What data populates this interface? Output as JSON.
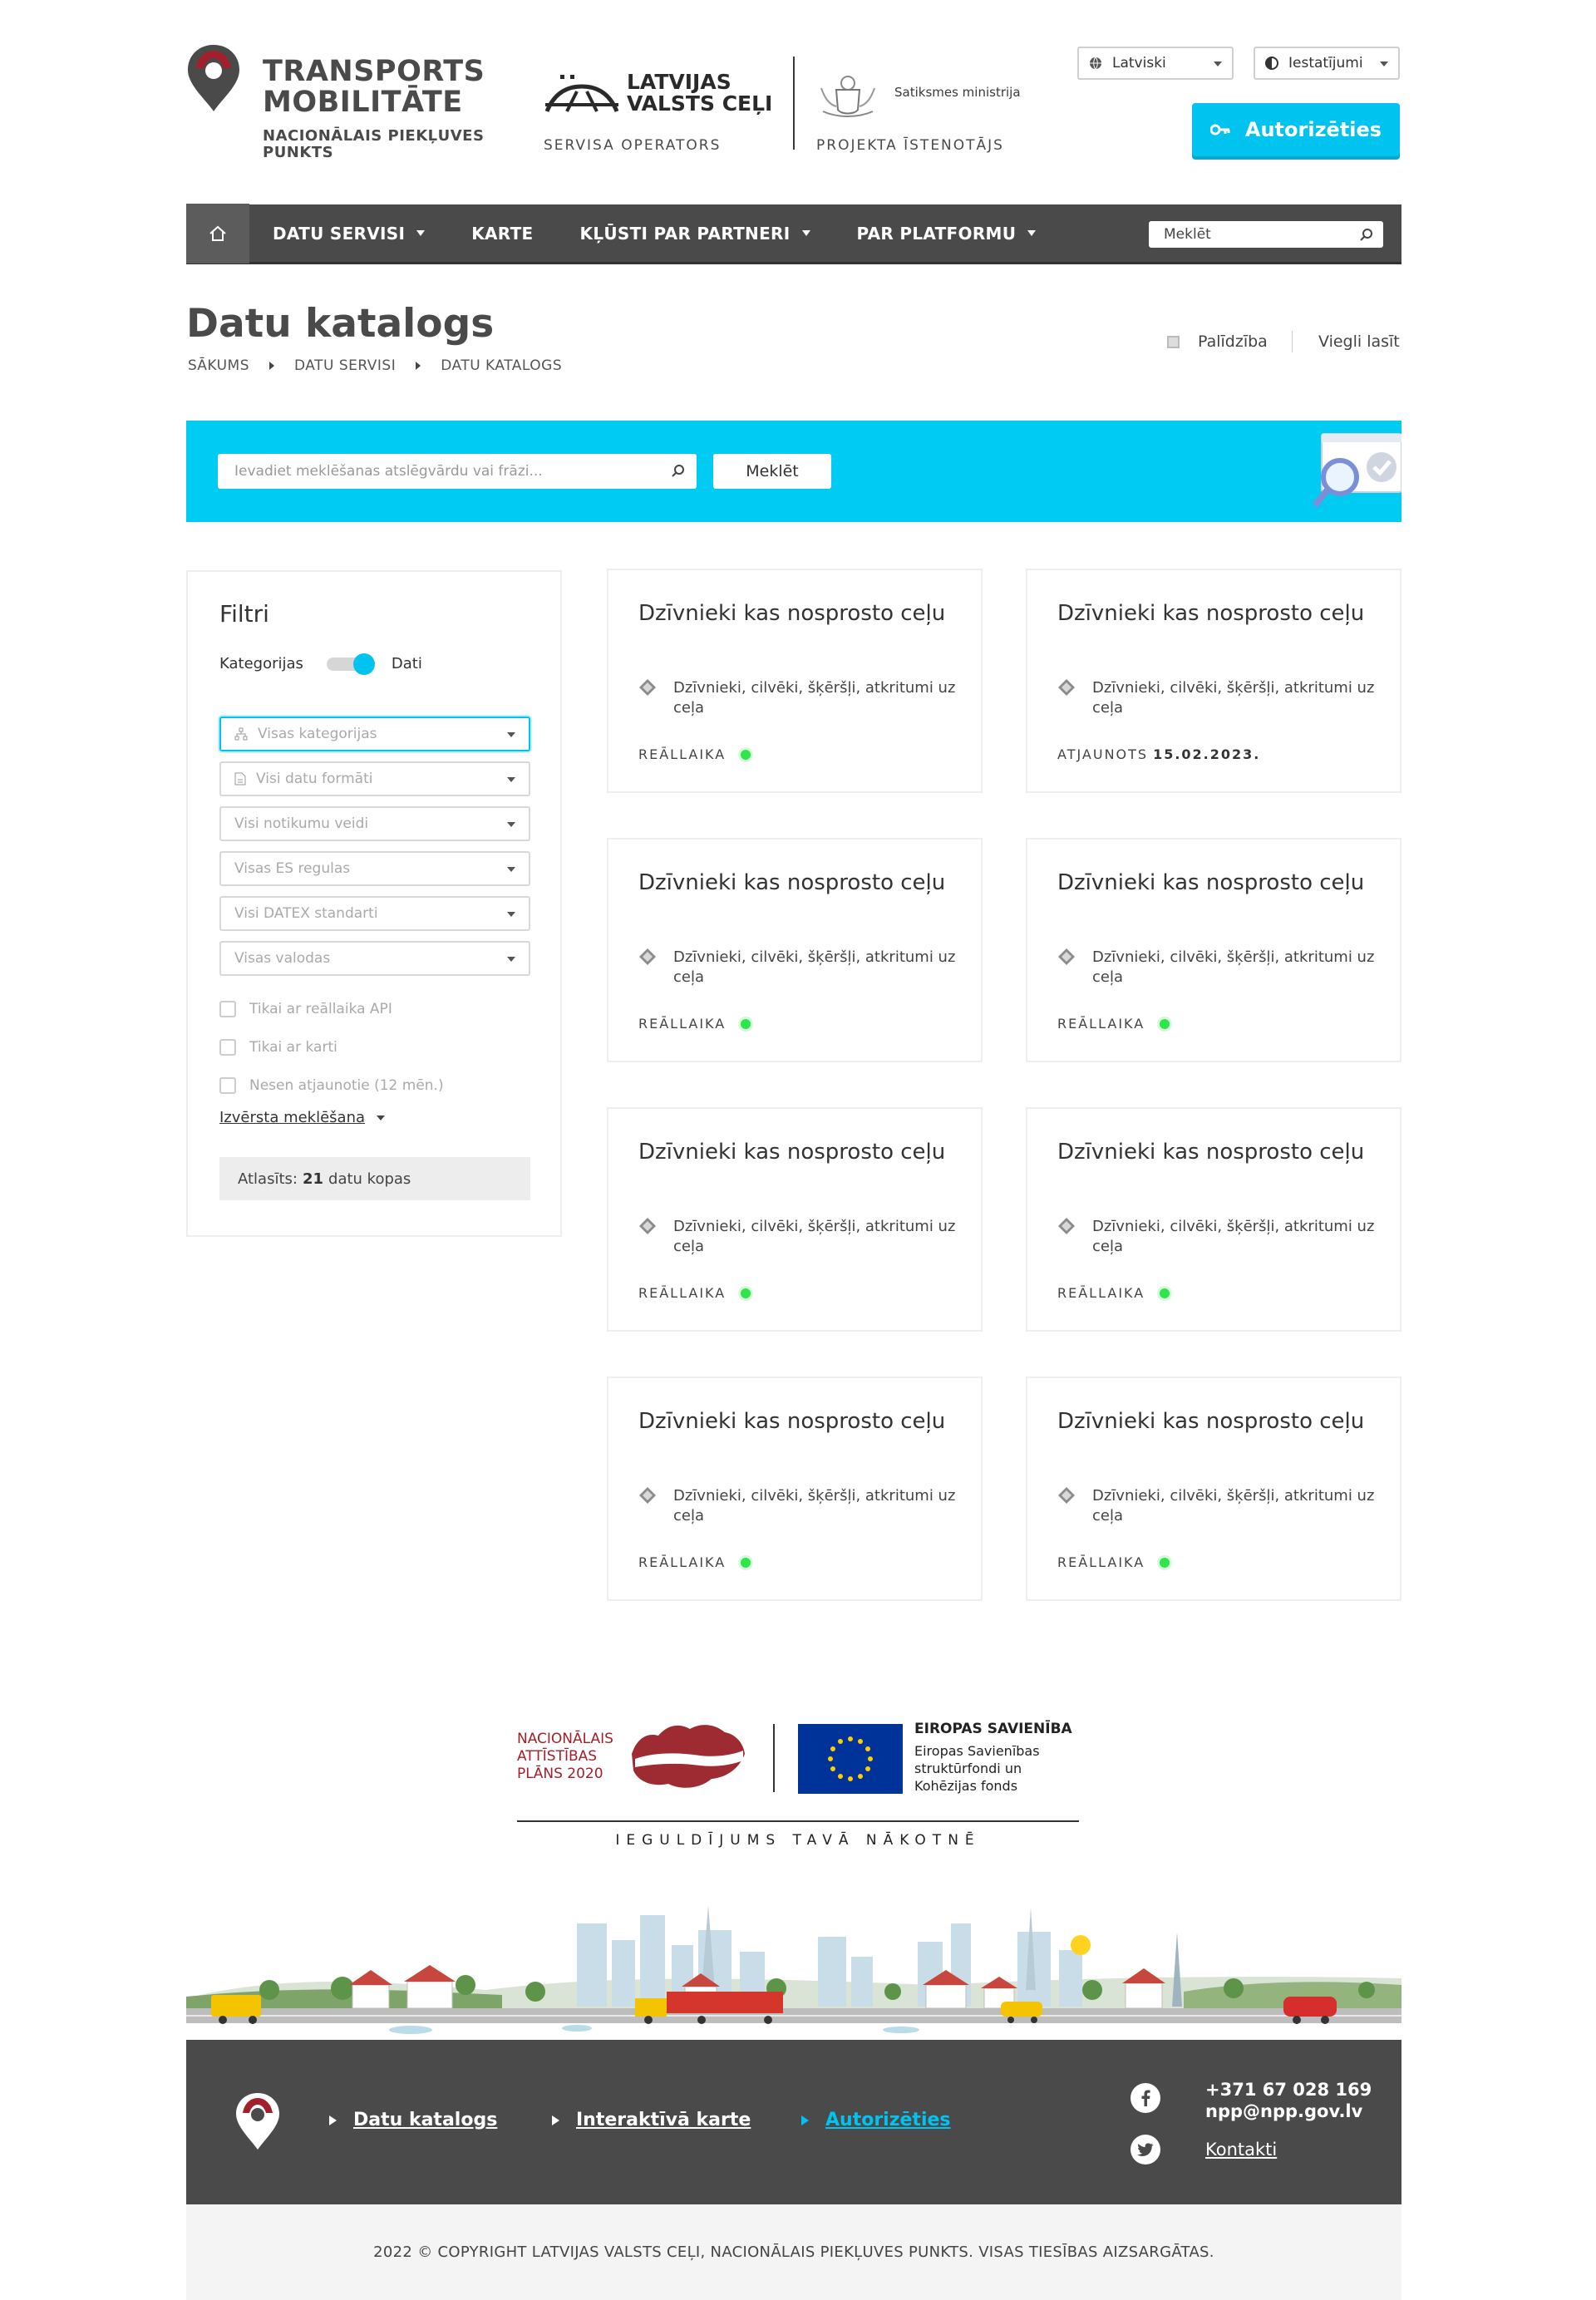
{
  "brand": {
    "title_line1": "TRANSPORTS",
    "title_line2": "MOBILITĀTE",
    "subtitle": "NACIONĀLAIS PIEKĻUVES PUNKTS"
  },
  "partners": {
    "operator_name_line1": "LATVIJAS",
    "operator_name_line2": "VALSTS CEĻI",
    "operator_role": "SERVISA OPERATORS",
    "ministry_name": "Satiksmes ministrija",
    "ministry_role": "PROJEKTA ĪSTENOTĀJS"
  },
  "header": {
    "language": "Latviski",
    "settings": "Iestatījumi",
    "login_button": "Autorizēties"
  },
  "nav": {
    "items": [
      {
        "label": "DATU SERVISI",
        "dropdown": true
      },
      {
        "label": "KARTE",
        "dropdown": false
      },
      {
        "label": "KĻŪSTI PAR PARTNERI",
        "dropdown": true
      },
      {
        "label": "PAR PLATFORMU",
        "dropdown": true
      }
    ],
    "search_placeholder": "Meklēt"
  },
  "page": {
    "title": "Datu katalogs",
    "breadcrumb": [
      "SĀKUMS",
      "DATU SERVISI",
      "DATU KATALOGS"
    ],
    "help_link": "Palīdzība",
    "easy_read": "Viegli lasīt"
  },
  "search": {
    "placeholder": "Ievadiet meklēšanas atslēgvārdu vai frāzi...",
    "button": "Meklēt"
  },
  "filters": {
    "title": "Filtri",
    "toggle_left": "Kategorijas",
    "toggle_right": "Dati",
    "selects": [
      "Visas kategorijas",
      "Visi datu formāti",
      "Visi notikumu veidi",
      "Visas ES regulas",
      "Visi DATEX standarti",
      "Visas valodas"
    ],
    "checkboxes": [
      "Tikai ar reāllaika API",
      "Tikai ar karti",
      "Nesen atjaunotie (12 mēn.)"
    ],
    "advanced": "Izvērsta meklēšana",
    "selected_prefix": "Atlasīts:",
    "selected_count": "21",
    "selected_suffix": "datu kopas"
  },
  "cards": [
    {
      "title": "Dzīvnieki kas nosprosto ceļu",
      "desc": "Dzīvnieki, cilvēki, šķēršļi, atkritumi uz ceļa",
      "status": "REĀLLAIKA",
      "live": true
    },
    {
      "title": "Dzīvnieki kas nosprosto ceļu",
      "desc": "Dzīvnieki, cilvēki, šķēršļi, atkritumi uz ceļa",
      "status": "ATJAUNOTS",
      "date": "15.02.2023.",
      "live": false
    },
    {
      "title": "Dzīvnieki kas nosprosto ceļu",
      "desc": "Dzīvnieki, cilvēki, šķēršļi, atkritumi uz ceļa",
      "status": "REĀLLAIKA",
      "live": true
    },
    {
      "title": "Dzīvnieki kas nosprosto ceļu",
      "desc": "Dzīvnieki, cilvēki, šķēršļi, atkritumi uz ceļa",
      "status": "REĀLLAIKA",
      "live": true
    },
    {
      "title": "Dzīvnieki kas nosprosto ceļu",
      "desc": "Dzīvnieki, cilvēki, šķēršļi, atkritumi uz ceļa",
      "status": "REĀLLAIKA",
      "live": true
    },
    {
      "title": "Dzīvnieki kas nosprosto ceļu",
      "desc": "Dzīvnieki, cilvēki, šķēršļi, atkritumi uz ceļa",
      "status": "REĀLLAIKA",
      "live": true
    },
    {
      "title": "Dzīvnieki kas nosprosto ceļu",
      "desc": "Dzīvnieki, cilvēki, šķēršļi, atkritumi uz ceļa",
      "status": "REĀLLAIKA",
      "live": true
    },
    {
      "title": "Dzīvnieki kas nosprosto ceļu",
      "desc": "Dzīvnieki, cilvēki, šķēršļi, atkritumi uz ceļa",
      "status": "REĀLLAIKA",
      "live": true
    }
  ],
  "funding": {
    "nap_line1": "NACIONĀLAIS",
    "nap_line2": "ATTĪSTĪBAS",
    "nap_line3": "PLĀNS 2020",
    "eu_title": "EIROPAS SAVIENĪBA",
    "eu_sub": "Eiropas Savienības struktūrfondi un Kohēzijas fonds",
    "motto": "IEGULDĪJUMS TAVĀ NĀKOTNĒ"
  },
  "footer": {
    "links": [
      "Datu katalogs",
      "Interaktīvā karte",
      "Autorizēties"
    ],
    "phone": "+371 67 028 169",
    "email": "npp@npp.gov.lv",
    "contacts": "Kontakti",
    "copyright": "2022 © COPYRIGHT LATVIJAS VALSTS CEĻI, NACIONĀLAIS PIEKĻUVES PUNKTS. VISAS TIESĪBAS AIZSARGĀTAS."
  },
  "colors": {
    "accent": "#00c3ef",
    "dark": "#4a4a4a",
    "brand_red": "#a3202a",
    "live_dot": "#2ee54a"
  }
}
